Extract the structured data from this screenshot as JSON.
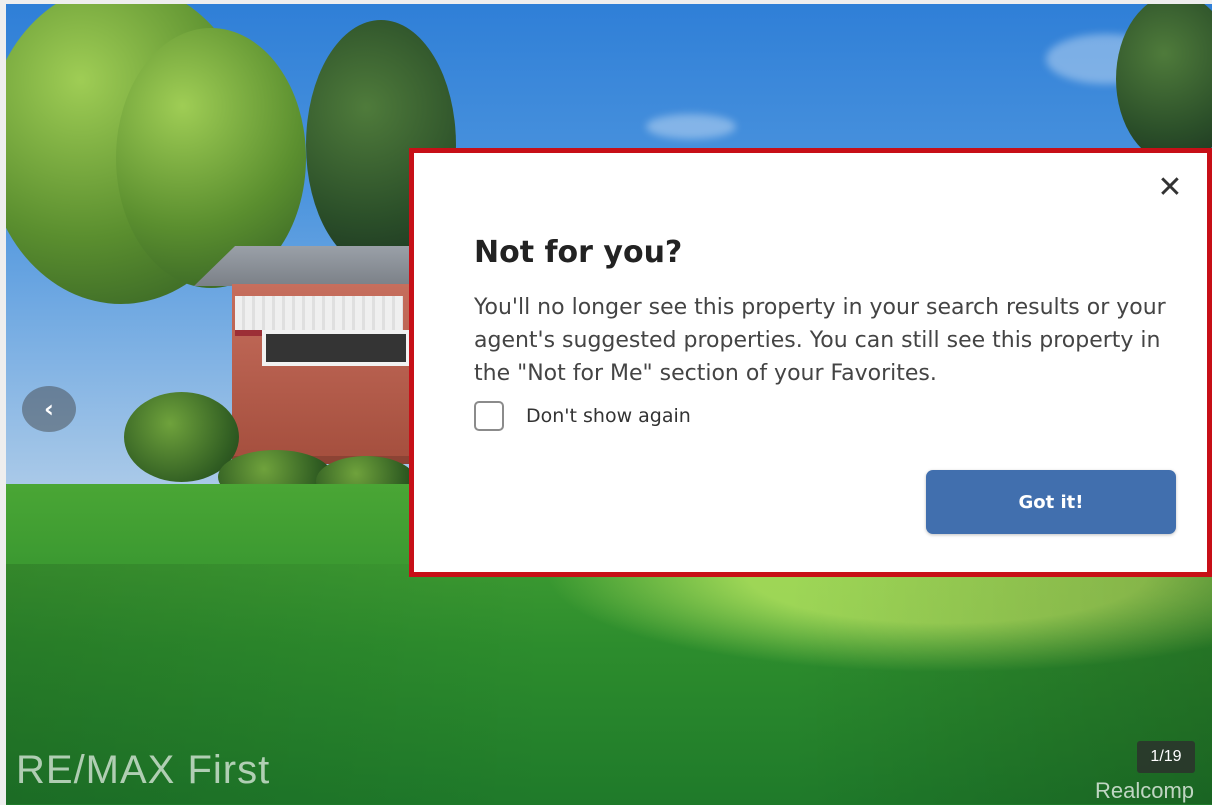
{
  "gallery": {
    "prev_icon": "chevron-left-icon",
    "prev_glyph": "‹",
    "watermark": "RE/MAX First",
    "counter": "1/19",
    "credit": "Realcomp"
  },
  "modal": {
    "title": "Not for you?",
    "message": "You'll no longer see this property in your search results or your agent's suggested properties. You can still see this property in the \"Not for Me\" section of your Favorites.",
    "checkbox_label": "Don't show again",
    "button_label": "Got it!",
    "close_icon": "close-icon",
    "close_glyph": "✕",
    "colors": {
      "border": "#c70f17",
      "button": "#416fae"
    }
  }
}
